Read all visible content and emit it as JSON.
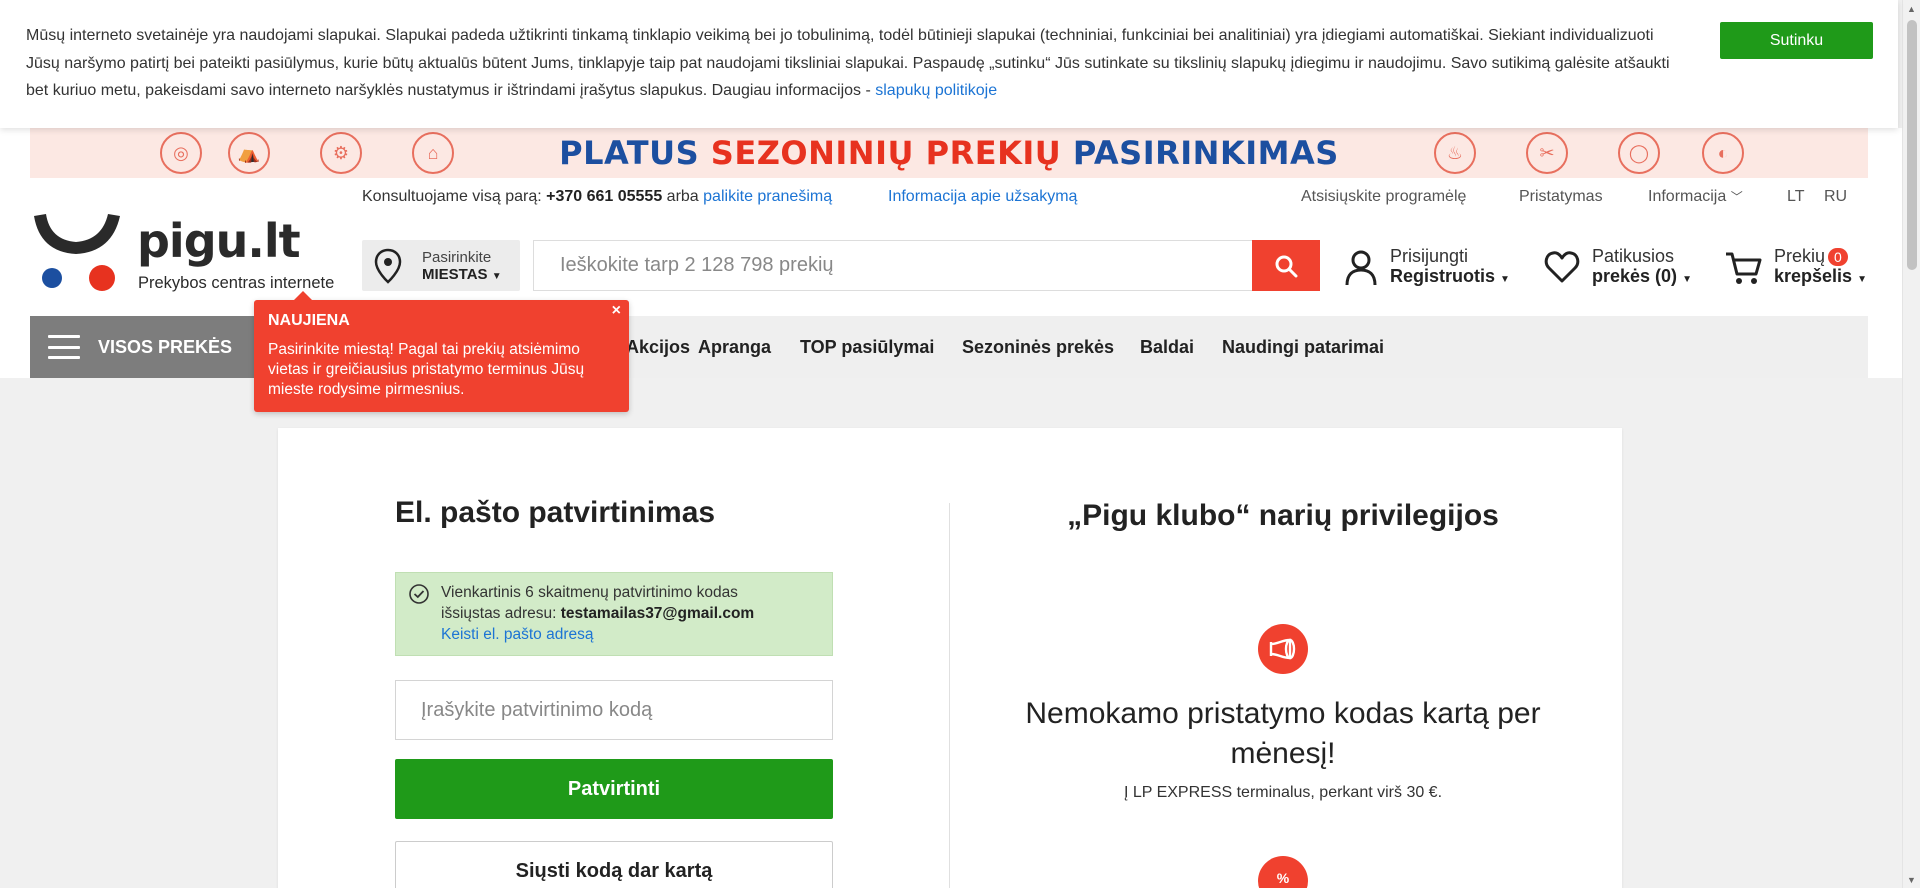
{
  "cookie": {
    "text": "Mūsų interneto svetainėje yra naudojami slapukai. Slapukai padeda užtikrinti tinkamą tinklapio veikimą bei jo tobulinimą, todėl būtinieji slapukai (techniniai, funkciniai bei analitiniai) yra įdiegiami automatiškai. Siekiant individualizuoti Jūsų naršymo patirtį bei pateikti pasiūlymus, kurie būtų aktualūs būtent Jums, tinklapyje taip pat naudojami tiksliniai slapukai. Paspaudę „sutinku“ Jūs sutinkate su tikslinių slapukų įdiegimu ir naudojimu. Savo sutikimą galėsite atšaukti bet kuriuo metu, pakeisdami savo interneto naršyklės nustatymus ir ištrindami įrašytus slapukus. Daugiau informacijos - ",
    "link": "slapukų politikoje",
    "accept": "Sutinku"
  },
  "banner": {
    "part1": "PLATUS ",
    "part2": "SEZONINIŲ PREKIŲ ",
    "part3": "PASIRINKIMAS"
  },
  "logo": {
    "name": "pigu.lt",
    "tagline": "Prekybos centras internete"
  },
  "topbar": {
    "consult_prefix": "Konsultuojame visą parą: ",
    "phone": "+370 661 05555",
    "or": " arba ",
    "leave_message": "palikite pranešimą",
    "order_info": "Informacija apie užsakymą",
    "download_app": "Atsisiųskite programėlę",
    "delivery": "Pristatymas",
    "information": "Informacija",
    "lang_lt": "LT",
    "lang_ru": "RU"
  },
  "city": {
    "label": "Pasirinkite",
    "value": "MIESTAS"
  },
  "search": {
    "placeholder": "Ieškokite tarp 2 128 798 prekių"
  },
  "account": {
    "login": "Prisijungti",
    "register": "Registruotis"
  },
  "favorites": {
    "line1": "Patikusios",
    "line2": "prekės (0)"
  },
  "cart": {
    "line1": "Prekių",
    "count": "0",
    "line2": "krepšelis"
  },
  "nav": {
    "all": "VISOS PREKĖS",
    "items": [
      "Akcijos",
      "Apranga",
      "TOP pasiūlymai",
      "Sezoninės prekės",
      "Baldai",
      "Naudingi patarimai"
    ]
  },
  "tooltip": {
    "title": "NAUJIENA",
    "text": "Pasirinkite miestą! Pagal tai prekių atsiėmimo vietas ir greičiausius pristatymo terminus Jūsų mieste rodysime pirmesnius.",
    "close": "×"
  },
  "verify": {
    "title": "El. pašto patvirtinimas",
    "info_line1": "Vienkartinis 6 skaitmenų patvirtinimo kodas",
    "info_line2_prefix": "išsiųstas adresu: ",
    "email": "testamailas37@gmail.com",
    "change_email": "Keisti el. pašto adresą",
    "code_placeholder": "Įrašykite patvirtinimo kodą",
    "confirm": "Patvirtinti",
    "resend": "Siųsti kodą dar kartą"
  },
  "club": {
    "title": "„Pigu klubo“ narių privilegijos",
    "benefit1_title": "Nemokamo pristatymo kodas kartą per mėnesį!",
    "benefit1_sub": "Į LP EXPRESS terminalus, perkant virš 30 €."
  },
  "colors": {
    "accent_red": "#f0412f",
    "green": "#1f9a19",
    "link_blue": "#1c74d4",
    "banner_blue": "#1c4fa0"
  }
}
